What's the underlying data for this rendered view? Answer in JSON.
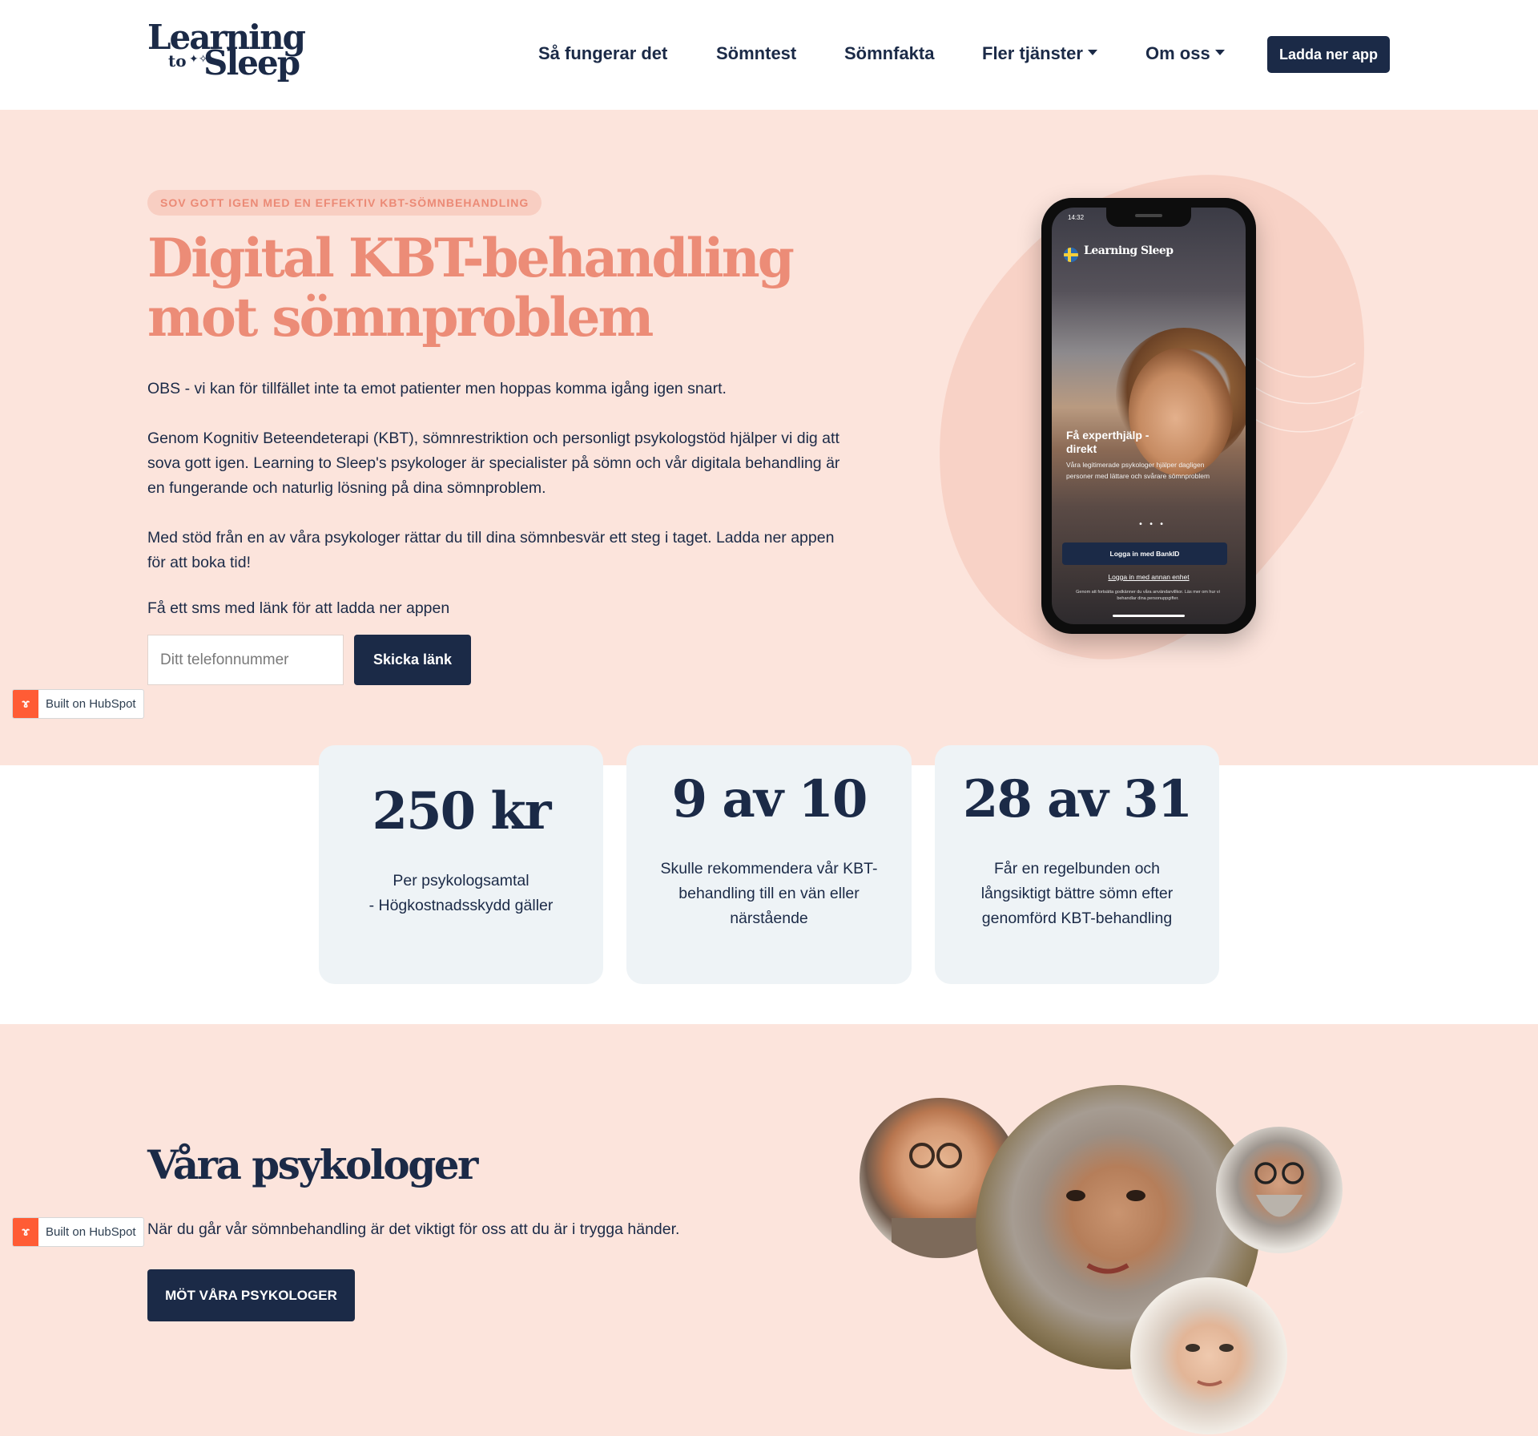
{
  "header": {
    "logo_line1": "Learning",
    "logo_to": "to",
    "logo_line2": "Sleep",
    "nav": [
      {
        "label": "Så fungerar det"
      },
      {
        "label": "Sömntest"
      },
      {
        "label": "Sömnfakta"
      },
      {
        "label": "Fler tjänster"
      },
      {
        "label": "Om oss"
      }
    ],
    "cta": "Ladda ner app"
  },
  "hero": {
    "eyebrow": "SOV GOTT IGEN MED EN EFFEKTIV KBT-SÖMNBEHANDLING",
    "title": "Digital KBT-behandling mot sömnproblem",
    "para1": "OBS - vi kan för tillfället inte ta emot patienter men hoppas komma igång igen snart.",
    "para2": "Genom Kognitiv Beteendeterapi (KBT), sömnrestriktion och personligt psykologstöd hjälper vi dig att sova gott igen. Learning to Sleep's psykologer är specialister på sömn och vår digitala behandling är en fungerande och naturlig lösning på dina sömnproblem.",
    "para3": "Med stöd från en av våra psykologer rättar du till dina sömnbesvär ett steg i taget. Ladda ner appen för att boka tid!",
    "sms_label": "Få ett sms med länk för att ladda ner appen",
    "phone_placeholder": "Ditt telefonnummer",
    "send_button": "Skicka länk"
  },
  "phone_screen": {
    "time": "14:32",
    "brand": "Learning Sleep",
    "headline": "Få experthjälp - direkt",
    "subtext": "Våra legitimerade psykologer hjälper dagligen personer med lättare och svårare sömnproblem",
    "dots": "• • •",
    "bankid_button": "Logga in med BankID",
    "other_device": "Logga in med annan enhet",
    "legal": "Genom att fortsätta godkänner du våra användarvillkor. Läs mer om hur vi behandlar dina personuppgifter."
  },
  "hubspot_badge": "Built on HubSpot",
  "stats": [
    {
      "value": "250 kr",
      "desc_line1": "Per psykologsamtal",
      "desc_line2": "- Högkostnadsskydd gäller"
    },
    {
      "value": "9 av 10",
      "desc": "Skulle rekommendera vår KBT-behandling till en vän eller närstående"
    },
    {
      "value": "28 av 31",
      "desc": "Får en regelbunden och långsiktigt bättre sömn efter genomförd KBT-behandling"
    }
  ],
  "psychologists": {
    "title": "Våra psykologer",
    "text": "När du går vår sömnbehandling är det viktigt för oss att du är i trygga händer.",
    "button": "MÖT VÅRA PSYKOLOGER"
  },
  "colors": {
    "navy": "#1b2a47",
    "peach_bg": "#fce4dc",
    "salmon": "#ec8c77",
    "card_bg": "#eef3f6",
    "hubspot_orange": "#ff5c35"
  }
}
